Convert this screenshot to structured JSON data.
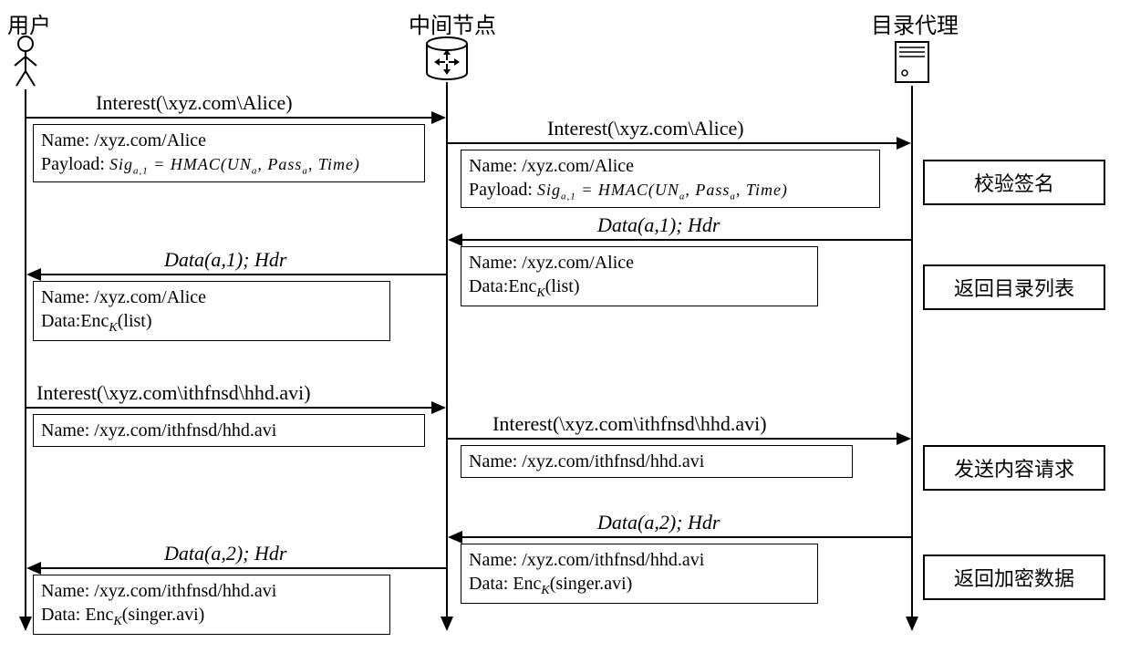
{
  "actors": {
    "user": "用户",
    "middle": "中间节点",
    "proxy": "目录代理"
  },
  "messages": {
    "interest1": "Interest(\\xyz.com\\Alice)",
    "interest1b": "Interest(\\xyz.com\\Alice)",
    "data1": "Data(a,1); Hdr",
    "data1b": "Data(a,1); Hdr",
    "interest2": "Interest(\\xyz.com\\ithfnsd\\hhd.avi)",
    "interest2b": "Interest(\\xyz.com\\ithfnsd\\hhd.avi)",
    "data2": "Data(a,2); Hdr",
    "data2b": "Data(a,2); Hdr"
  },
  "boxes": {
    "b1_name": "Name: /xyz.com/Alice",
    "b1_payload_label": "Payload: ",
    "b1_payload_eq": "Sig",
    "b1_payload_rhs": " = HMAC(UN",
    "b1_payload_pass": ", Pass",
    "b1_payload_time": ", Time)",
    "b2_name": "Name: /xyz.com/Alice",
    "b2_data_label": "Data:",
    "b2_data_enc": "Enc",
    "b2_data_arg": "(list)",
    "b3_name": "Name: /xyz.com/ithfnsd/hhd.avi",
    "b4_name": "Name: /xyz.com/ithfnsd/hhd.avi",
    "b4_data_label": "Data: ",
    "b4_data_enc": "Enc",
    "b4_data_arg": "(singer.avi)",
    "sub_a1": "a,1",
    "sub_a": "a",
    "sub_K": "K"
  },
  "actions": {
    "a1": "校验签名",
    "a2": "返回目录列表",
    "a3": "发送内容请求",
    "a4": "返回加密数据"
  }
}
